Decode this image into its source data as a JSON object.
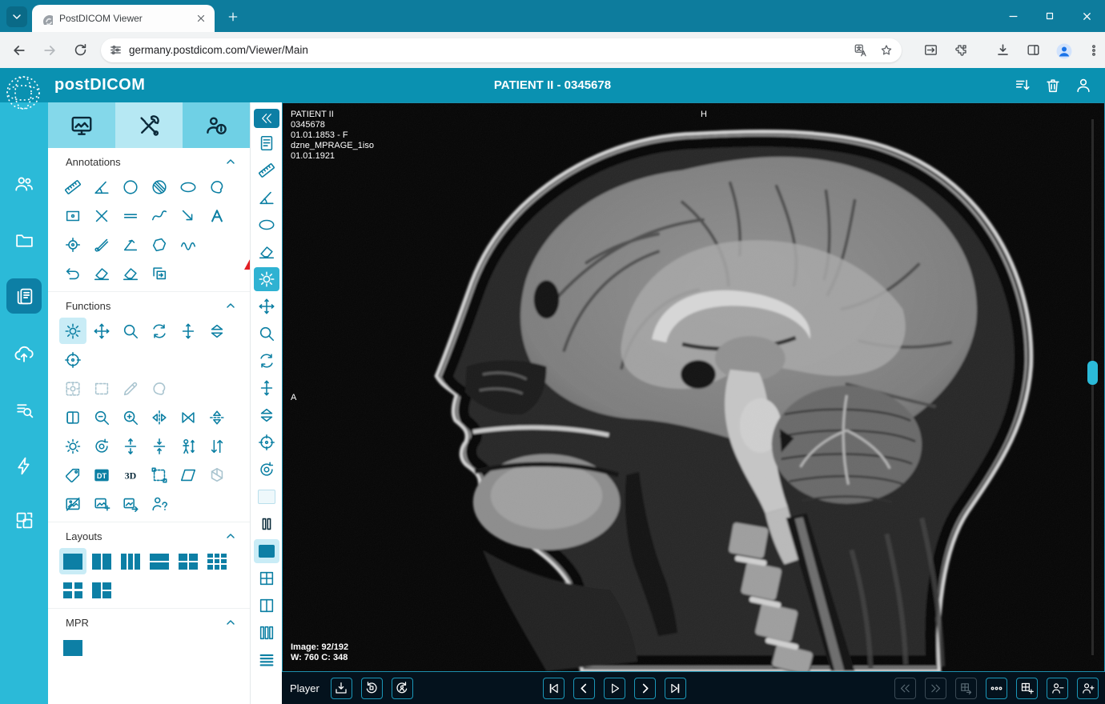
{
  "browser": {
    "tab_title": "PostDICOM Viewer",
    "url": "germany.postdicom.com/Viewer/Main"
  },
  "header": {
    "logo": "postDICOM",
    "title": "PATIENT II - 0345678"
  },
  "sidebar": {
    "items": [
      "patients",
      "folders",
      "studies",
      "cloud-upload",
      "search-list",
      "quick-actions",
      "transfer"
    ],
    "active_item": "studies"
  },
  "panel": {
    "tabs": [
      "viewer-display",
      "tools",
      "patient-info"
    ],
    "active_tab": "tools",
    "sections": {
      "annotations": "Annotations",
      "functions": "Functions",
      "layouts": "Layouts",
      "mpr": "MPR"
    },
    "annotation_tools": [
      "length-ruler",
      "angle",
      "circle-roi",
      "shaded-circle-roi",
      "ellipse-roi",
      "freehand-roi",
      "rectangle-roi",
      "cross-marker",
      "parallel-lines",
      "polyline",
      "arrow",
      "text",
      "point-marker",
      "probe",
      "cobb-angle",
      "closed-polygon",
      "spline",
      "undo",
      "eraser",
      "clear-annotations",
      "copy-annotations"
    ],
    "function_tools": [
      "window-level",
      "pan",
      "magnify",
      "rotate",
      "resize",
      "stack-scroll",
      "localizer",
      "window-preset",
      "crop",
      "draw",
      "segment",
      "invert",
      "zoom-out",
      "zoom-in",
      "flip-horizontal",
      "mirror",
      "flip-vertical",
      "rotate-ccw-settings",
      "rotate-cw-settings",
      "expand-vertical",
      "collapse-vertical",
      "true-size",
      "swap-stack",
      "tag",
      "dicom-tags",
      "render-3d",
      "select-region",
      "oblique",
      "cube-3d",
      "hide-image",
      "add-image",
      "export-image",
      "patient-lookup"
    ],
    "layout_tools": [
      "1x1",
      "1x2",
      "1x3",
      "2x1",
      "2x2",
      "3x3",
      "2x2-grid",
      "1-plus-2"
    ],
    "dt_label": "DT",
    "threed_label": "3D",
    "question_mark": "?"
  },
  "viewer_toolbar": {
    "tools": [
      "collapse-panel",
      "report",
      "length-ruler",
      "angle",
      "ellipse-roi",
      "eraser",
      "window-level",
      "pan",
      "magnify",
      "rotate",
      "resize",
      "stack-scroll",
      "localizer",
      "rotate-3d",
      "series-single",
      "pause",
      "series-selected",
      "grid-2x2",
      "grid-1x2",
      "grid-columns",
      "grid-rows"
    ],
    "selected": "window-level"
  },
  "viewport": {
    "overlay": {
      "patient_name": "PATIENT II",
      "patient_id": "0345678",
      "birth_line": "01.01.1853 - F",
      "series_desc": "dzne_MPRAGE_1iso",
      "study_date": "01.01.1921",
      "orientation_top": "H",
      "orientation_left": "A",
      "image_counter": "Image: 92/192",
      "window_level": "W: 760 C: 348"
    }
  },
  "player": {
    "label": "Player",
    "buttons": [
      "export",
      "rotate-ccw",
      "rotate-cw",
      "first-image",
      "previous-image",
      "play",
      "next-image",
      "last-image",
      "previous-series",
      "next-series",
      "export-grid",
      "more-options",
      "add-viewport",
      "remove-user",
      "add-user"
    ],
    "disabled_buttons": [
      "previous-series",
      "next-series",
      "export-grid"
    ]
  },
  "colors": {
    "chrome_teal": "#0d7c9d",
    "header_teal": "#0a91b1",
    "sidebar_cyan": "#2bbad8",
    "icon_teal": "#0b7fa3",
    "selected_bg": "#c9ecf6",
    "annotation_arrow_red": "#e31e24",
    "player_bg": "#04121d"
  }
}
